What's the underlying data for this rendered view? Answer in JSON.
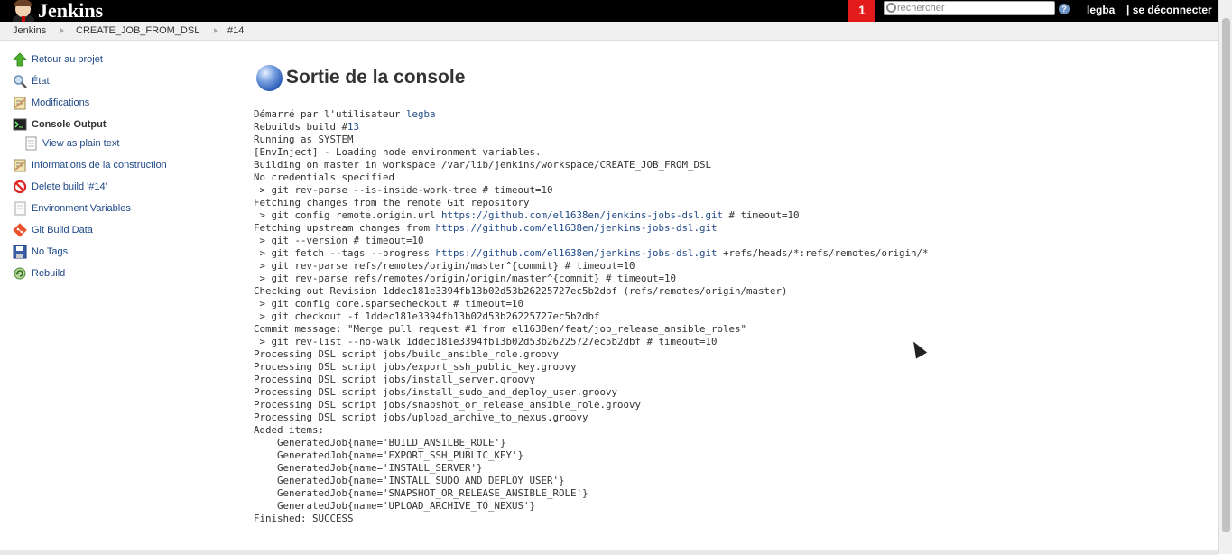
{
  "header": {
    "app_name": "Jenkins",
    "notification_count": "1",
    "search_placeholder": "rechercher",
    "help": "?",
    "user": "legba",
    "logout": "| se déconnecter"
  },
  "breadcrumbs": [
    "Jenkins",
    "CREATE_JOB_FROM_DSL",
    "#14"
  ],
  "sidebar": {
    "items": [
      {
        "label": "Retour au projet",
        "icon": "up-arrow-icon"
      },
      {
        "label": "État",
        "icon": "search-icon"
      },
      {
        "label": "Modifications",
        "icon": "notepad-icon"
      },
      {
        "label": "Console Output",
        "icon": "terminal-icon"
      },
      {
        "label": "View as plain text",
        "icon": "document-icon"
      },
      {
        "label": "Informations de la construction",
        "icon": "notepad-icon"
      },
      {
        "label": "Delete build '#14'",
        "icon": "no-entry-icon"
      },
      {
        "label": "Environment Variables",
        "icon": "document-icon"
      },
      {
        "label": "Git Build Data",
        "icon": "git-icon"
      },
      {
        "label": "No Tags",
        "icon": "save-icon"
      },
      {
        "label": "Rebuild",
        "icon": "rebuild-icon"
      }
    ]
  },
  "main": {
    "title": "Sortie de la console",
    "console": {
      "line1_prefix": "Démarré par l'utilisateur ",
      "line1_link": "legba",
      "line2_prefix": "Rebuilds build #",
      "line2_link": "13",
      "block1": "Running as SYSTEM\n[EnvInject] - Loading node environment variables.\nBuilding on master in workspace /var/lib/jenkins/workspace/CREATE_JOB_FROM_DSL\nNo credentials specified\n > git rev-parse --is-inside-work-tree # timeout=10\nFetching changes from the remote Git repository\n > git config remote.origin.url ",
      "repo_link_1": "https://github.com/el1638en/jenkins-jobs-dsl.git",
      "block2": " # timeout=10\nFetching upstream changes from ",
      "repo_link_2": "https://github.com/el1638en/jenkins-jobs-dsl.git",
      "block3": "\n > git --version # timeout=10\n > git fetch --tags --progress ",
      "repo_link_3": "https://github.com/el1638en/jenkins-jobs-dsl.git",
      "block4": " +refs/heads/*:refs/remotes/origin/*\n > git rev-parse refs/remotes/origin/master^{commit} # timeout=10\n > git rev-parse refs/remotes/origin/origin/master^{commit} # timeout=10\nChecking out Revision 1ddec181e3394fb13b02d53b26225727ec5b2dbf (refs/remotes/origin/master)\n > git config core.sparsecheckout # timeout=10\n > git checkout -f 1ddec181e3394fb13b02d53b26225727ec5b2dbf\nCommit message: \"Merge pull request #1 from el1638en/feat/job_release_ansible_roles\"\n > git rev-list --no-walk 1ddec181e3394fb13b02d53b26225727ec5b2dbf # timeout=10\nProcessing DSL script jobs/build_ansible_role.groovy\nProcessing DSL script jobs/export_ssh_public_key.groovy\nProcessing DSL script jobs/install_server.groovy\nProcessing DSL script jobs/install_sudo_and_deploy_user.groovy\nProcessing DSL script jobs/snapshot_or_release_ansible_role.groovy\nProcessing DSL script jobs/upload_archive_to_nexus.groovy\nAdded items:\n    GeneratedJob{name='BUILD_ANSILBE_ROLE'}\n    GeneratedJob{name='EXPORT_SSH_PUBLIC_KEY'}\n    GeneratedJob{name='INSTALL_SERVER'}\n    GeneratedJob{name='INSTALL_SUDO_AND_DEPLOY_USER'}\n    GeneratedJob{name='SNAPSHOT_OR_RELEASE_ANSIBLE_ROLE'}\n    GeneratedJob{name='UPLOAD_ARCHIVE_TO_NEXUS'}\nFinished: SUCCESS"
    }
  },
  "colors": {
    "header_bg": "#000000",
    "notification_bg": "#e31b1b",
    "link": "#204a87"
  }
}
